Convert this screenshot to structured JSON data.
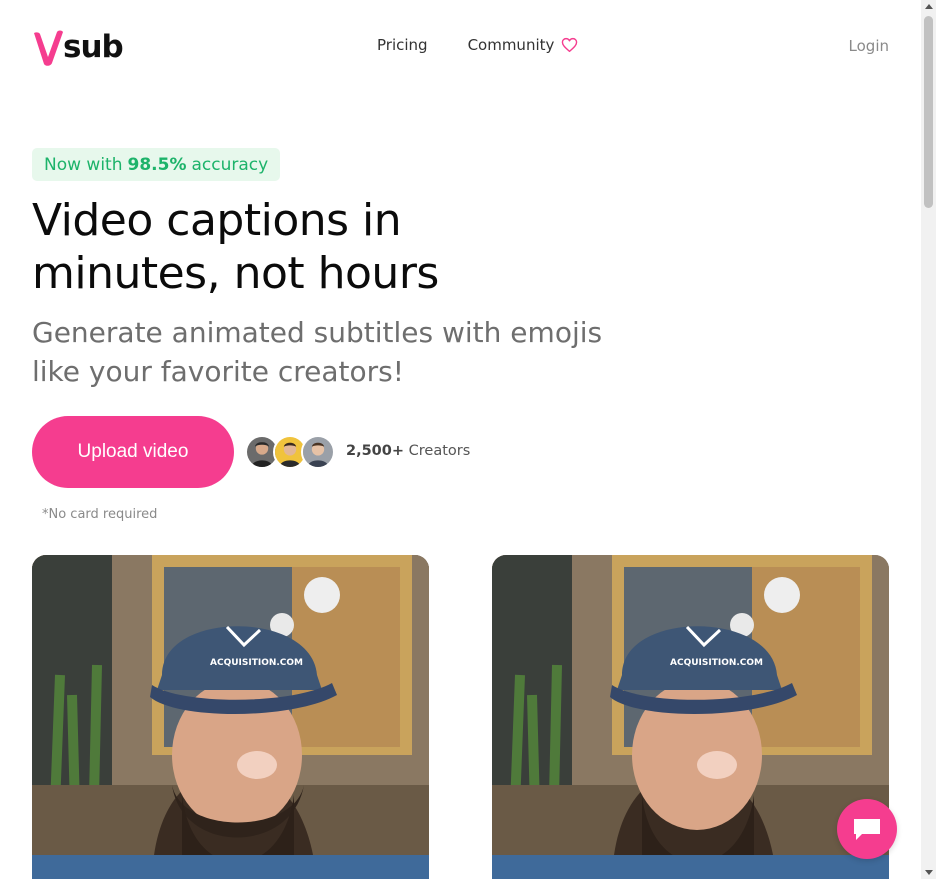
{
  "brand": {
    "logo_letter": "V",
    "logo_text": "sub",
    "accent_color": "#f53d8f"
  },
  "nav": {
    "pricing_label": "Pricing",
    "community_label": "Community",
    "community_icon": "heart-icon",
    "login_label": "Login"
  },
  "hero": {
    "badge_prefix": "Now with",
    "badge_value": "98.5%",
    "badge_suffix": "accuracy",
    "headline_line1": "Video captions in",
    "headline_line2": "minutes, not hours",
    "subhead_line1": "Generate animated subtitles with emojis",
    "subhead_line2": "like your favorite creators!",
    "cta_label": "Upload video",
    "creators_count": "2,500+",
    "creators_label": "Creators",
    "no_card_note": "*No card required"
  },
  "videos": [
    {
      "caption": "",
      "logo_text": "ACQUISITION.COM"
    },
    {
      "caption": "",
      "logo_text": "ACQUISITION.COM"
    }
  ],
  "chat": {
    "icon": "chat-bubble-icon"
  }
}
